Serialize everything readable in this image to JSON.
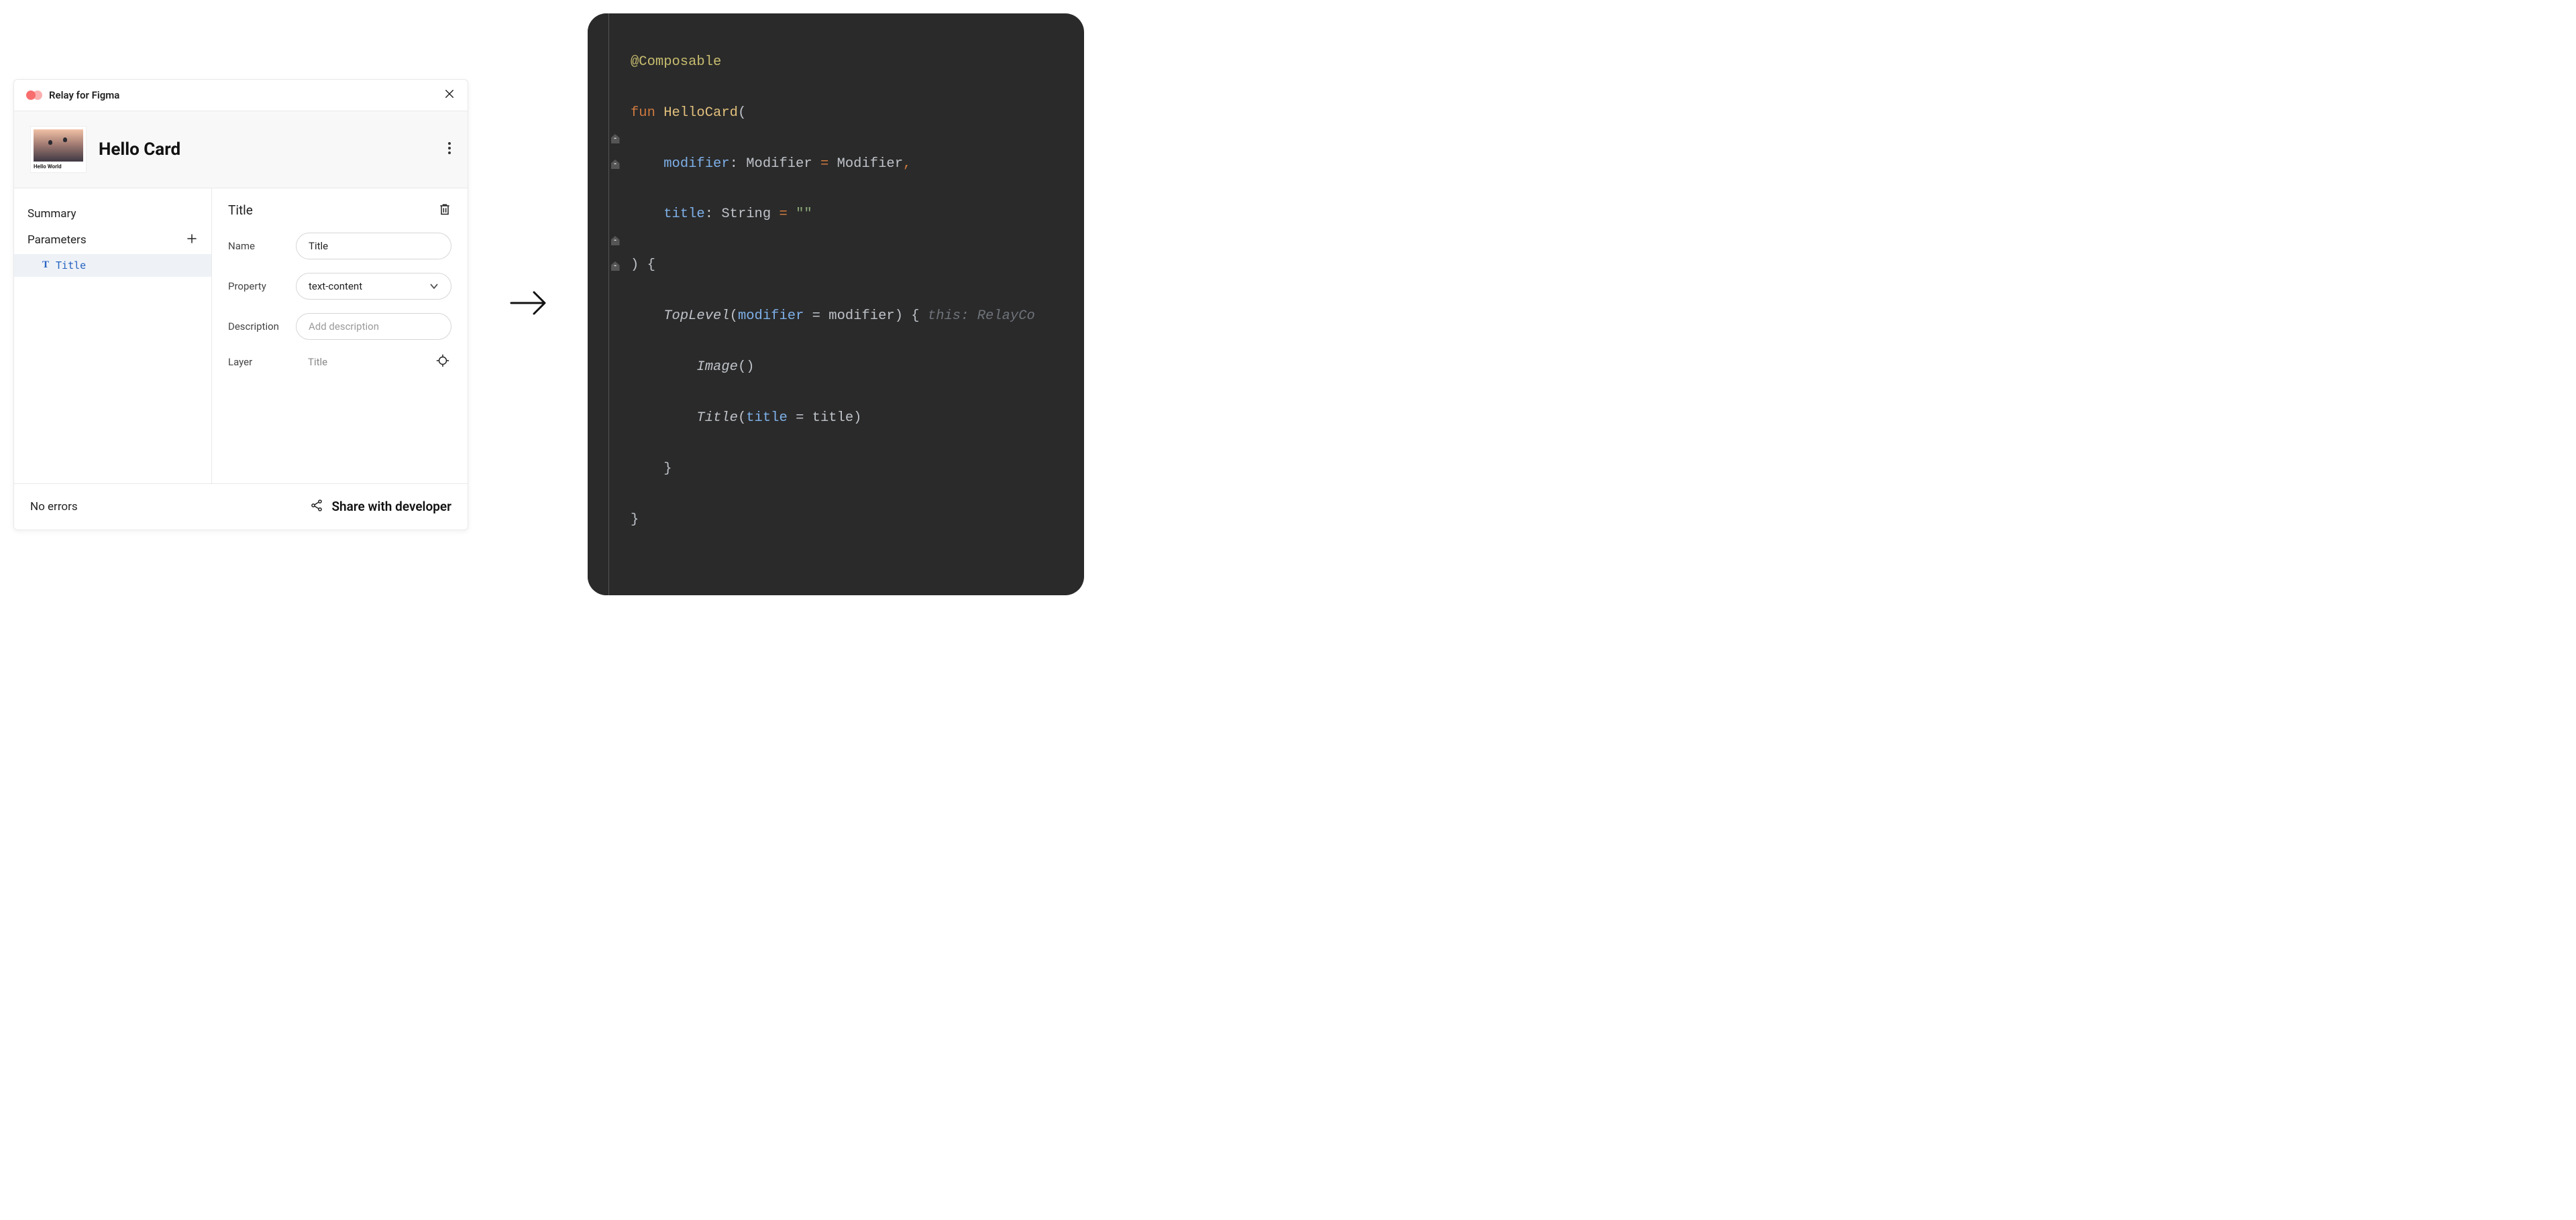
{
  "plugin": {
    "title": "Relay for Figma",
    "thumbnail_label": "Hello World",
    "component_name": "Hello Card"
  },
  "sidebar": {
    "summary_label": "Summary",
    "parameters_label": "Parameters",
    "parameters": [
      {
        "name": "Title"
      }
    ]
  },
  "detail": {
    "heading": "Title",
    "fields": {
      "name_label": "Name",
      "name_value": "Title",
      "property_label": "Property",
      "property_value": "text-content",
      "description_label": "Description",
      "description_placeholder": "Add description",
      "layer_label": "Layer",
      "layer_value": "Title"
    }
  },
  "footer": {
    "errors": "No errors",
    "share_label": "Share with developer"
  },
  "code": {
    "l1": {
      "anno": "@Composable"
    },
    "l2": {
      "kw": "fun ",
      "fn": "HelloCard",
      "paren": "("
    },
    "l3": {
      "indent": "    ",
      "param": "modifier",
      "colon": ": ",
      "type": "Modifier ",
      "eq": "= ",
      "val": "Modifier",
      "comma": ","
    },
    "l4": {
      "indent": "    ",
      "param": "title",
      "colon": ": ",
      "type": "String ",
      "eq": "= ",
      "str": "\"\""
    },
    "l5": {
      "text": ") {"
    },
    "l6": {
      "indent": "    ",
      "call": "TopLevel",
      "open": "(",
      "arg": "modifier",
      "mid": " = modifier) { ",
      "hint": "this: RelayCo"
    },
    "l7": {
      "indent": "        ",
      "call": "Image",
      "rest": "()"
    },
    "l8": {
      "indent": "        ",
      "call": "Title",
      "open": "(",
      "arg": "title",
      "mid": " = title)"
    },
    "l9": {
      "indent": "    ",
      "brace": "}"
    },
    "l10": {
      "brace": "}"
    }
  }
}
